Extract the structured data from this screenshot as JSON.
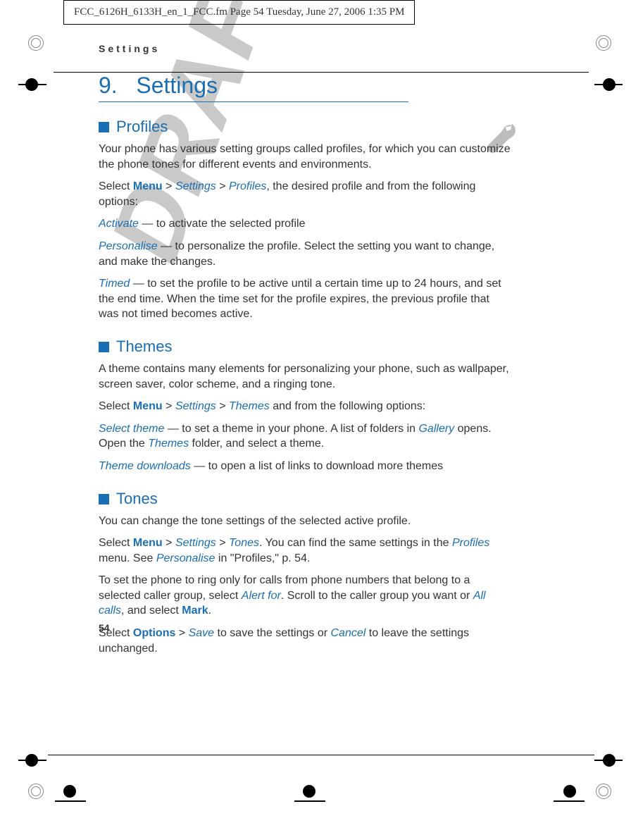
{
  "header_line": "FCC_6126H_6133H_en_1_FCC.fm  Page 54  Tuesday, June 27, 2006  1:35 PM",
  "running_head": "Settings",
  "chapter": {
    "num": "9.",
    "title": "Settings"
  },
  "page_number": "54",
  "watermark": "DRAFT",
  "profiles": {
    "heading": "Profiles",
    "p1_a": "Your phone has various setting groups called profiles, for which you can customize the phone tones for different events and environments.",
    "p2_pre": "Select ",
    "menu": "Menu",
    "gt": " > ",
    "settings": "Settings",
    "profiles_link": "Profiles",
    "p2_post": ", the desired profile and from the following options:",
    "activate": "Activate",
    "activate_txt": " — to activate the selected profile",
    "personalise": "Personalise",
    "personalise_txt": " — to personalize the profile. Select the setting you want to change, and make the changes.",
    "timed": "Timed",
    "timed_txt": " — to set the profile to be active until a certain time up to 24 hours, and set the end time. When the time set for the profile expires, the previous profile that was not timed becomes active."
  },
  "themes": {
    "heading": "Themes",
    "p1": "A theme contains many elements for personalizing your phone, such as wallpaper, screen saver, color scheme, and a ringing tone.",
    "p2_pre": "Select ",
    "menu": "Menu",
    "gt": " > ",
    "settings": "Settings",
    "themes_link": "Themes",
    "p2_post": " and from the following options:",
    "select_theme": "Select theme",
    "select_theme_txt_a": " — to set a theme in your phone. A list of folders in ",
    "gallery": "Gallery",
    "select_theme_txt_b": " opens. Open the ",
    "themes_folder": "Themes",
    "select_theme_txt_c": " folder, and select a theme.",
    "theme_downloads": "Theme downloads",
    "theme_downloads_txt": " — to open a list of links to download more themes"
  },
  "tones": {
    "heading": "Tones",
    "p1": "You can change the tone settings of the selected active profile.",
    "p2_pre": "Select ",
    "menu": "Menu",
    "gt": " > ",
    "settings": "Settings",
    "tones_link": "Tones",
    "p2_mid": ". You can find the same settings in the ",
    "profiles_link": "Profiles",
    "p2_mid2": " menu. See ",
    "personalise": "Personalise",
    "p2_post": " in \"Profiles,\" p. 54.",
    "p3_a": "To set the phone to ring only for calls from phone numbers that belong to a selected caller group, select ",
    "alert_for": "Alert for",
    "p3_b": ". Scroll to the caller group you want or ",
    "all_calls": "All calls",
    "p3_c": ", and select ",
    "mark": "Mark",
    "p3_d": ".",
    "p4_a": "Select ",
    "options": "Options",
    "gt2": " > ",
    "save": "Save",
    "p4_b": " to save the settings or ",
    "cancel": "Cancel",
    "p4_c": " to leave the settings unchanged."
  }
}
